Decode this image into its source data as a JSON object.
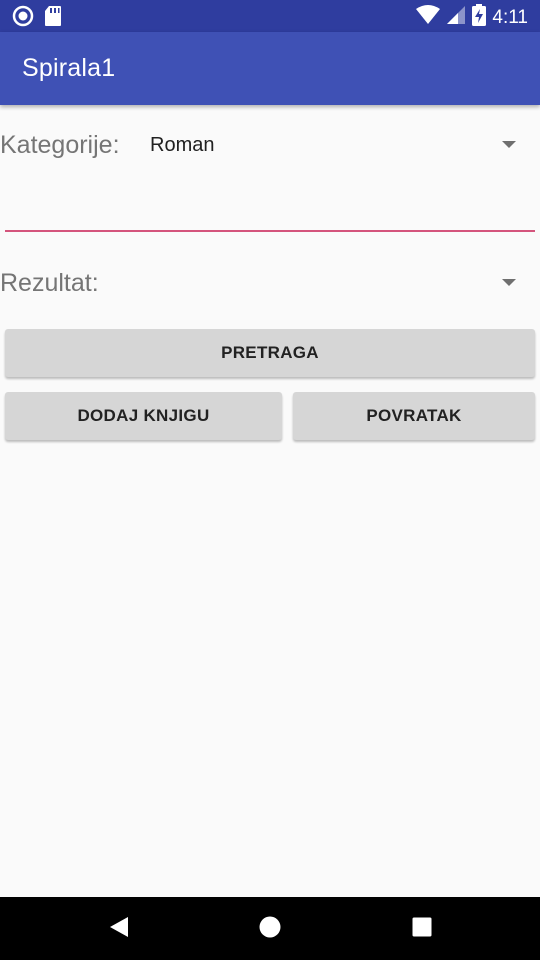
{
  "status_bar": {
    "time": "4:11",
    "icons": [
      "circle-notification-icon",
      "sd-card-icon",
      "wifi-icon",
      "cell-signal-icon",
      "battery-charging-icon"
    ]
  },
  "app_bar": {
    "title": "Spirala1",
    "color": "#3f51b5"
  },
  "form": {
    "category_label": "Kategorije:",
    "category_value": "Roman",
    "search_value": "",
    "search_underline_color": "#d4547c",
    "result_label": "Rezultat:",
    "result_value": ""
  },
  "buttons": {
    "search_label": "PRETRAGA",
    "add_book_label": "DODAJ KNJIGU",
    "back_label": "POVRATAK"
  },
  "nav_bar": {
    "icons": [
      "back-icon",
      "home-icon",
      "recents-icon"
    ]
  }
}
